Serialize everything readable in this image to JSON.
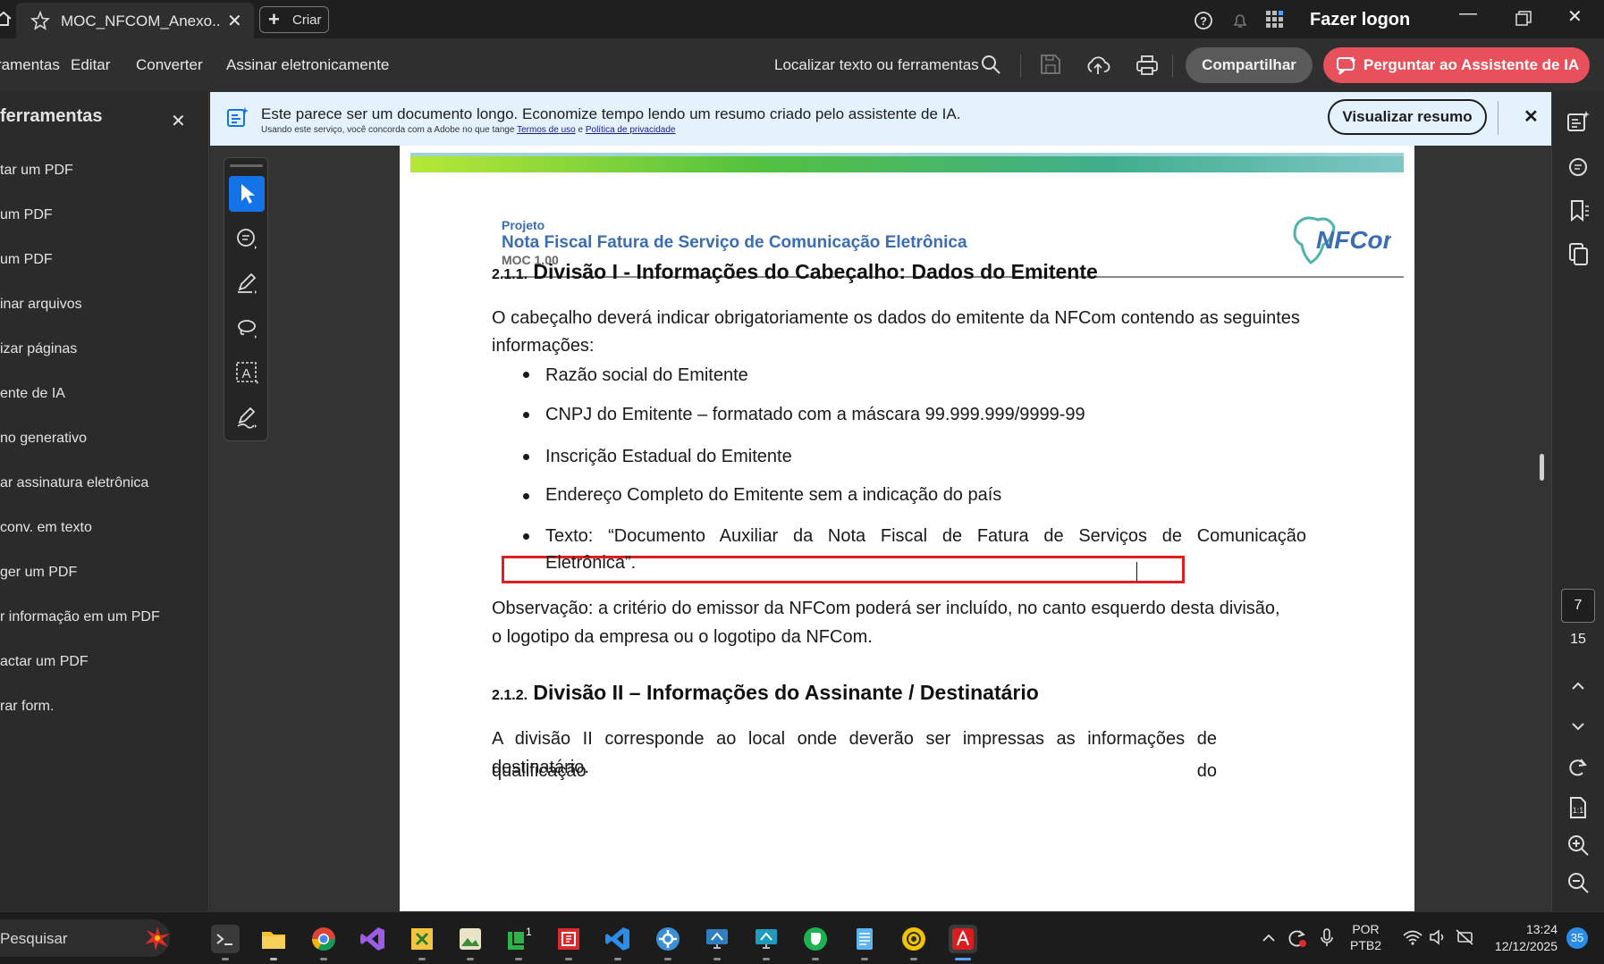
{
  "titlebar": {
    "tab_title": "MOC_NFCOM_Anexo...",
    "tab_close": "✕",
    "create_label": "Criar",
    "login_label": "Fazer logon"
  },
  "menubar": {
    "items": [
      "ramentas",
      "Editar",
      "Converter",
      "Assinar eletronicamente"
    ],
    "search_label": "Localizar texto ou ferramentas",
    "share_label": "Compartilhar",
    "ai_label": "Perguntar ao Assistente de IA"
  },
  "leftpanel": {
    "title": "ferramentas",
    "close": "✕",
    "items": [
      "tar um PDF",
      " um PDF",
      "um PDF",
      "inar arquivos",
      "izar páginas",
      "ente de IA",
      "no generativo",
      "ar assinatura eletrônica",
      " conv. em texto",
      "ger um PDF",
      "r informação em um PDF",
      "actar um PDF",
      "rar form."
    ]
  },
  "banner": {
    "text": "Este parece ser um documento longo. Economize tempo lendo um resumo criado pelo assistente de IA.",
    "sub_prefix": "Usando este serviço, você concorda com a Adobe no que tange",
    "terms": "Termos de uso",
    "sub_and": "e",
    "privacy": "Política de privacidade",
    "button": "Visualizar resumo",
    "close": "✕"
  },
  "document": {
    "header_project": "Projeto",
    "header_title": "Nota Fiscal Fatura de Serviço de Comunicação Eletrônica",
    "header_moc": "MOC 1.00",
    "logo_text": "NFCom",
    "logo_sub": "Nota Fiscal Fatura de Serviço de Comunicação Eletrônica",
    "section1_num": "2.1.1.",
    "section1_title": "Divisão I - Informações do Cabeçalho: Dados do Emitente",
    "para1_line1": "O cabeçalho deverá indicar obrigatoriamente os dados do emitente da NFCom contendo as seguintes",
    "para1_line2": "informações:",
    "bullets": [
      "Razão social do Emitente",
      "CNPJ do Emitente – formatado com a máscara 99.999.999/9999-99",
      "Inscrição Estadual do Emitente",
      "Endereço Completo do Emitente sem a indicação do país"
    ],
    "bullet5_line1": "Texto: “Documento Auxiliar da Nota Fiscal de Fatura de Serviços de Comunicação",
    "bullet5_line2": "Eletrônica”.",
    "obs_line1": "Observação: a critério do emissor da NFCom poderá ser incluído, no canto esquerdo desta divisão,",
    "obs_line2": "o logotipo da empresa ou o logotipo da NFCom.",
    "section2_num": "2.1.2.",
    "section2_title": "Divisão II – Informações do Assinante / Destinatário",
    "para2_line1": "A divisão II corresponde ao local onde deverão ser impressas as informações de qualificação do",
    "para2_line2": "destinatário."
  },
  "rightrail": {
    "current_page": "7",
    "total_pages": "15"
  },
  "taskbar": {
    "search_label": "Pesquisar",
    "lang_line1": "POR",
    "lang_line2": "PTB2",
    "time": "13:24",
    "date": "12/12/2025",
    "notif_count": "35"
  },
  "colors": {
    "accent_blue": "#1473e6",
    "ai_button": "#e8505b",
    "highlight_box": "#e02020",
    "doc_heading_blue": "#3a6db3"
  }
}
